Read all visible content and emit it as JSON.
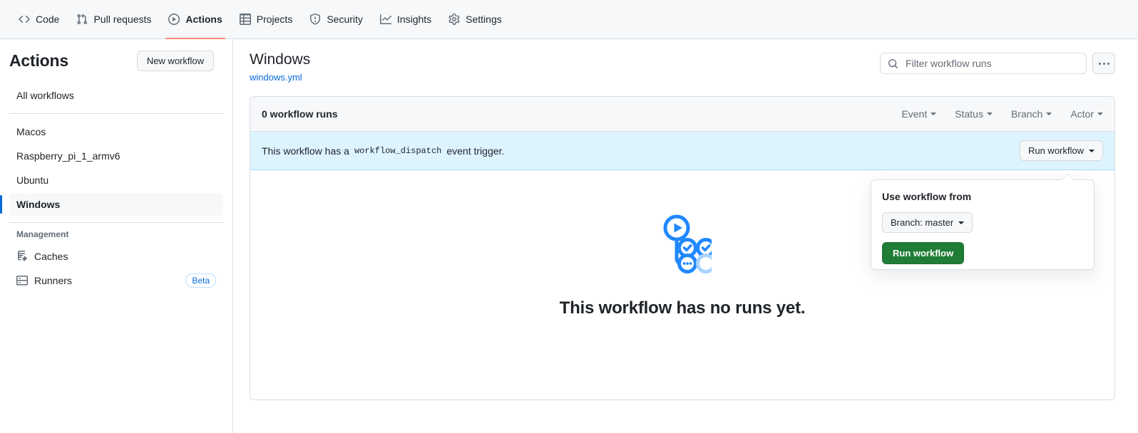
{
  "repo_nav": {
    "items": [
      {
        "label": "Code",
        "icon": "code-icon",
        "active": false
      },
      {
        "label": "Pull requests",
        "icon": "git-pull-request-icon",
        "active": false
      },
      {
        "label": "Actions",
        "icon": "play-circle-icon",
        "active": true
      },
      {
        "label": "Projects",
        "icon": "table-icon",
        "active": false
      },
      {
        "label": "Security",
        "icon": "shield-icon",
        "active": false
      },
      {
        "label": "Insights",
        "icon": "graph-icon",
        "active": false
      },
      {
        "label": "Settings",
        "icon": "gear-icon",
        "active": false
      }
    ]
  },
  "sidebar": {
    "title": "Actions",
    "new_workflow_label": "New workflow",
    "all_workflows_label": "All workflows",
    "workflows": [
      {
        "label": "Macos",
        "selected": false
      },
      {
        "label": "Raspberry_pi_1_armv6",
        "selected": false
      },
      {
        "label": "Ubuntu",
        "selected": false
      },
      {
        "label": "Windows",
        "selected": true
      }
    ],
    "management_label": "Management",
    "management": [
      {
        "label": "Caches",
        "icon": "cache-icon",
        "badge": ""
      },
      {
        "label": "Runners",
        "icon": "server-icon",
        "badge": "Beta"
      }
    ]
  },
  "main": {
    "workflow_title": "Windows",
    "workflow_file": "windows.yml",
    "search": {
      "placeholder": "Filter workflow runs",
      "value": "",
      "icon": "search-icon"
    },
    "kebab_icon": "kebab-horizontal-icon",
    "runs_count_label": "0 workflow runs",
    "filters": [
      {
        "label": "Event"
      },
      {
        "label": "Status"
      },
      {
        "label": "Branch"
      },
      {
        "label": "Actor"
      }
    ],
    "dispatch_banner": {
      "text_before": "This workflow has a",
      "code": "workflow_dispatch",
      "text_after": "event trigger.",
      "run_button_label": "Run workflow"
    },
    "empty_state": {
      "title": "This workflow has no runs yet.",
      "illustration": "workflow-runs-illustration"
    }
  },
  "run_workflow_dropdown": {
    "title": "Use workflow from",
    "branch_label": "Branch: master",
    "submit_label": "Run workflow"
  },
  "colors": {
    "accent": "#0969da",
    "active_tab_underline": "#fd8c73",
    "banner_bg": "#ddf4ff",
    "success_green": "#1f7d35",
    "border": "#d8dee4",
    "muted_text": "#636c76"
  }
}
